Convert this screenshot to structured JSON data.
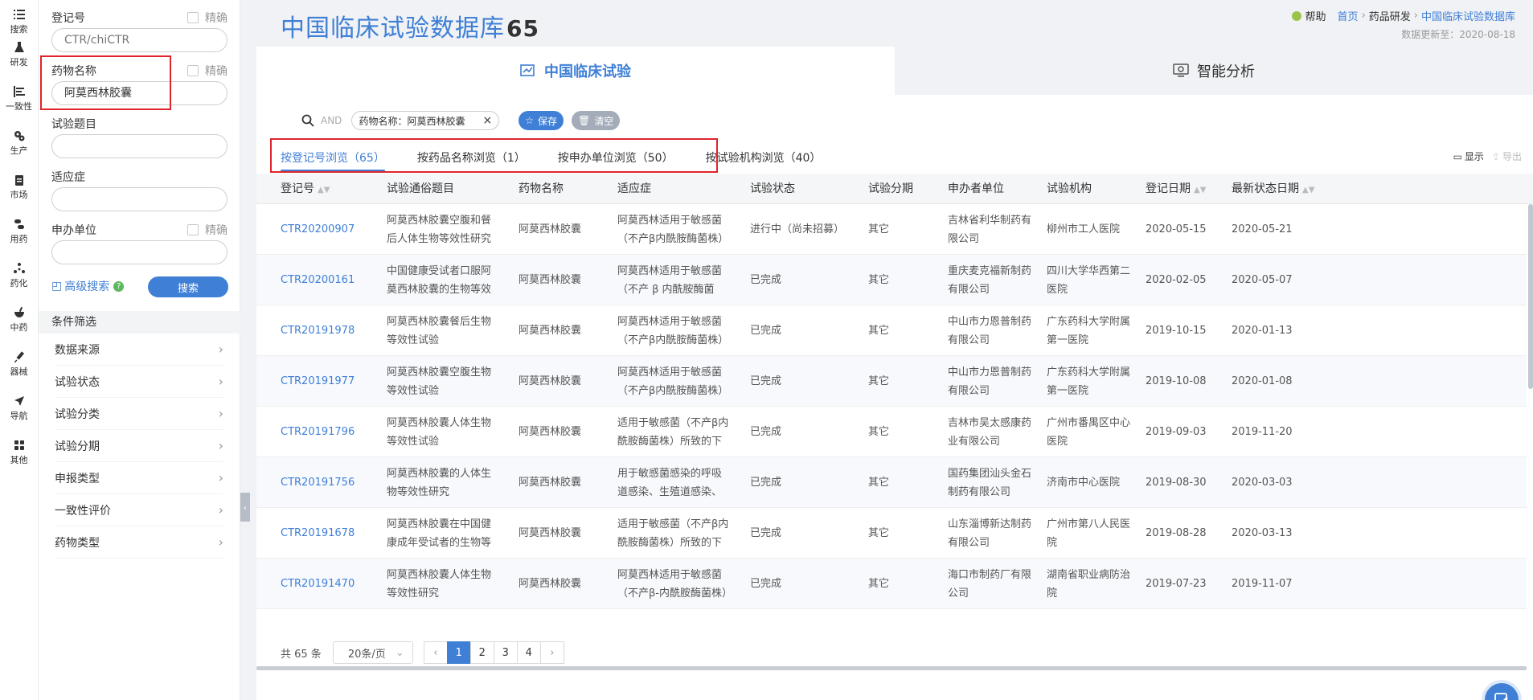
{
  "rail": [
    {
      "label": "搜索",
      "icon": "search-list-icon"
    },
    {
      "label": "研发",
      "icon": "flask-icon"
    },
    {
      "label": "一致性",
      "icon": "bars-icon"
    },
    {
      "label": "生产",
      "icon": "gears-icon"
    },
    {
      "label": "市场",
      "icon": "clipboard-icon"
    },
    {
      "label": "用药",
      "icon": "pills-icon"
    },
    {
      "label": "药化",
      "icon": "molecule-icon"
    },
    {
      "label": "中药",
      "icon": "mortar-icon"
    },
    {
      "label": "器械",
      "icon": "syringe-icon"
    },
    {
      "label": "导航",
      "icon": "navigation-icon"
    },
    {
      "label": "其他",
      "icon": "grid-icon"
    }
  ],
  "filter": {
    "reg_label": "登记号",
    "reg_placeholder": "CTR/chiCTR",
    "exact_label": "精确",
    "drug_label": "药物名称",
    "drug_value": "阿莫西林胶囊",
    "topic_label": "试验题目",
    "indication_label": "适应症",
    "sponsor_label": "申办单位",
    "advanced_label": "高级搜索",
    "search_label": "搜索",
    "conditions_title": "条件筛选",
    "conditions": [
      "数据来源",
      "试验状态",
      "试验分类",
      "试验分期",
      "申报类型",
      "一致性评价",
      "药物类型"
    ]
  },
  "header": {
    "title": "中国临床试验数据库",
    "count": "65",
    "help": "帮助",
    "crumbs": [
      "首页",
      "药品研发",
      "中国临床试验数据库"
    ],
    "updated": "数据更新至：2020-08-18"
  },
  "bigtabs": [
    "中国临床试验",
    "智能分析"
  ],
  "query": {
    "and": "AND",
    "chip": "药物名称：阿莫西林胶囊",
    "save": "保存",
    "clear": "清空"
  },
  "subtabs": [
    "按登记号浏览（65）",
    "按药品名称浏览（1）",
    "按申办单位浏览（50）",
    "按试验机构浏览（40）"
  ],
  "tools": {
    "show": "显示",
    "export": "导出"
  },
  "columns": [
    "登记号",
    "试验通俗题目",
    "药物名称",
    "适应症",
    "试验状态",
    "试验分期",
    "申办者单位",
    "试验机构",
    "登记日期",
    "最新状态日期"
  ],
  "rows": [
    {
      "id": "CTR20200907",
      "title": "阿莫西林胶囊空腹和餐后人体生物等效性研究",
      "drug": "阿莫西林胶囊",
      "ind": "阿莫西林适用于敏感菌（不产β内酰胺酶菌株）所致...",
      "status": "进行中（尚未招募）",
      "phase": "其它",
      "sponsor": "吉林省利华制药有限公司",
      "inst": "柳州市工人医院",
      "reg": "2020-05-15",
      "last": "2020-05-21"
    },
    {
      "id": "CTR20200161",
      "title": "中国健康受试者口服阿莫西林胶囊的生物等效性试验",
      "drug": "阿莫西林胶囊",
      "ind": "阿莫西林适用于敏感菌（不产 β 内酰胺酶菌株）所致...",
      "status": "已完成",
      "phase": "其它",
      "sponsor": "重庆麦克福新制药有限公司",
      "inst": "四川大学华西第二医院",
      "reg": "2020-02-05",
      "last": "2020-05-07"
    },
    {
      "id": "CTR20191978",
      "title": "阿莫西林胶囊餐后生物等效性试验",
      "drug": "阿莫西林胶囊",
      "ind": "阿莫西林适用于敏感菌（不产β内酰胺酶菌株）所致...",
      "status": "已完成",
      "phase": "其它",
      "sponsor": "中山市力恩普制药有限公司",
      "inst": "广东药科大学附属第一医院",
      "reg": "2019-10-15",
      "last": "2020-01-13"
    },
    {
      "id": "CTR20191977",
      "title": "阿莫西林胶囊空腹生物等效性试验",
      "drug": "阿莫西林胶囊",
      "ind": "阿莫西林适用于敏感菌（不产β内酰胺酶菌株）所致...",
      "status": "已完成",
      "phase": "其它",
      "sponsor": "中山市力恩普制药有限公司",
      "inst": "广东药科大学附属第一医院",
      "reg": "2019-10-08",
      "last": "2020-01-08"
    },
    {
      "id": "CTR20191796",
      "title": "阿莫西林胶囊人体生物等效性试验",
      "drug": "阿莫西林胶囊",
      "ind": "适用于敏感菌（不产β内酰胺酶菌株）所致的下列感...",
      "status": "已完成",
      "phase": "其它",
      "sponsor": "吉林市吴太感康药业有限公司",
      "inst": "广州市番禺区中心医院",
      "reg": "2019-09-03",
      "last": "2019-11-20"
    },
    {
      "id": "CTR20191756",
      "title": "阿莫西林胶囊的人体生物等效性研究",
      "drug": "阿莫西林胶囊",
      "ind": "用于敏感菌感染的呼吸道感染、生殖道感染、皮肤软...",
      "status": "已完成",
      "phase": "其它",
      "sponsor": "国药集团汕头金石制药有限公司",
      "inst": "济南市中心医院",
      "reg": "2019-08-30",
      "last": "2020-03-03"
    },
    {
      "id": "CTR20191678",
      "title": "阿莫西林胶囊在中国健康成年受试者的生物等效性研究",
      "drug": "阿莫西林胶囊",
      "ind": "适用于敏感菌（不产β内酰胺酶菌株）所致的下列感...",
      "status": "已完成",
      "phase": "其它",
      "sponsor": "山东淄博新达制药有限公司",
      "inst": "广州市第八人民医院",
      "reg": "2019-08-28",
      "last": "2020-03-13"
    },
    {
      "id": "CTR20191470",
      "title": "阿莫西林胶囊人体生物等效性研究",
      "drug": "阿莫西林胶囊",
      "ind": "阿莫西林适用于敏感菌（不产β-内酰胺酶菌株）所致...",
      "status": "已完成",
      "phase": "其它",
      "sponsor": "海口市制药厂有限公司",
      "inst": "湖南省职业病防治院",
      "reg": "2019-07-23",
      "last": "2019-11-07"
    }
  ],
  "pager": {
    "total": "共 65 条",
    "size": "20条/页",
    "pages": [
      "1",
      "2",
      "3",
      "4"
    ]
  }
}
